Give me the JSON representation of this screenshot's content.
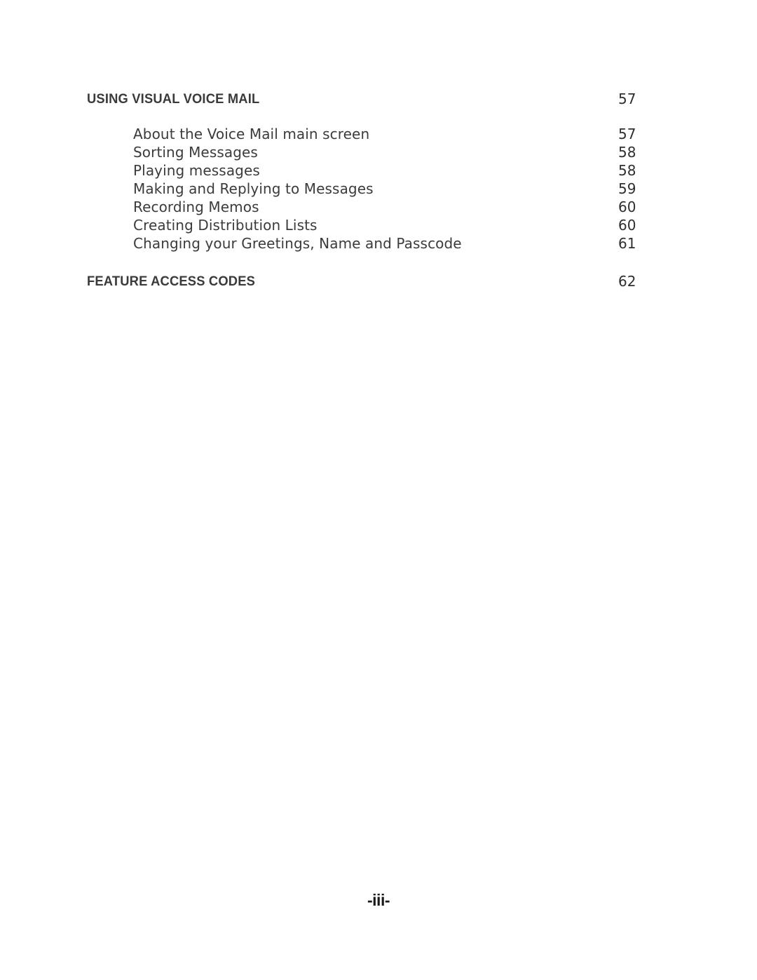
{
  "document": {
    "page_marker": "-iii-"
  },
  "toc": {
    "sections": [
      {
        "title": "USING VISUAL VOICE MAIL",
        "page": "57",
        "entries": [
          {
            "label": "About the Voice Mail main screen",
            "page": "57"
          },
          {
            "label": "Sorting Messages",
            "page": "58"
          },
          {
            "label": "Playing messages",
            "page": "58"
          },
          {
            "label": "Making and Replying to Messages",
            "page": "59"
          },
          {
            "label": "Recording Memos",
            "page": "60"
          },
          {
            "label": "Creating Distribution Lists",
            "page": "60"
          },
          {
            "label": "Changing your Greetings, Name and Passcode",
            "page": "61"
          }
        ]
      },
      {
        "title": "FEATURE ACCESS CODES",
        "page": "62",
        "entries": []
      }
    ]
  }
}
